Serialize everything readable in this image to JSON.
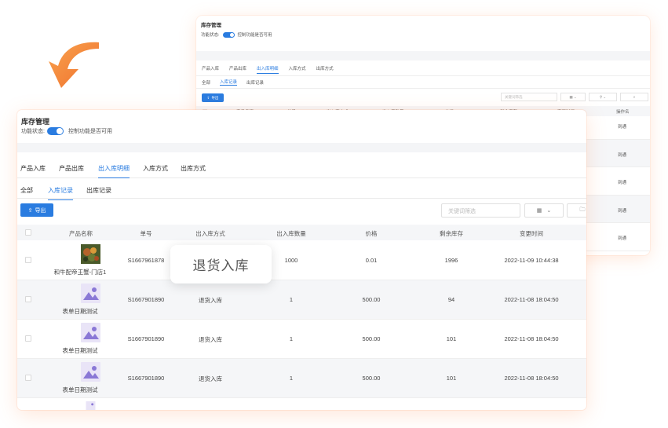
{
  "colors": {
    "accent": "#2a7ce0",
    "arrow": "#f5873a"
  },
  "back_panel": {
    "title": "库存管理",
    "status_label": "功能状态:",
    "status_desc": "控制功能是否可用",
    "tabs": [
      "产品入库",
      "产品出库",
      "出入库明细",
      "入库方式",
      "出库方式"
    ],
    "active_tab": 2,
    "subtabs": [
      "全部",
      "入库记录",
      "出库记录"
    ],
    "active_subtab": 1,
    "export_label": "导出",
    "search_placeholder": "关键词筛选",
    "columns": [
      "产品名称",
      "单号",
      "出入库方式",
      "出入库数量",
      "价格",
      "剩余库存",
      "变更时间",
      "操作名"
    ],
    "row_action": "到通"
  },
  "front_panel": {
    "title": "库存管理",
    "status_label": "功能状态:",
    "status_desc": "控制功能是否可用",
    "tabs": [
      "产品入库",
      "产品出库",
      "出入库明细",
      "入库方式",
      "出库方式"
    ],
    "active_tab": 2,
    "subtabs": [
      "全部",
      "入库记录",
      "出库记录"
    ],
    "active_subtab": 1,
    "export_label": "导出",
    "search_placeholder": "关键词筛选",
    "columns": [
      "产品名称",
      "单号",
      "出入库方式",
      "出入库数量",
      "价格",
      "剩余库存",
      "变更时间"
    ],
    "rows": [
      {
        "name": "和牛配帝王蟹-门店1",
        "order": "S1667961878",
        "method": "",
        "qty": "1000",
        "price": "0.01",
        "stock": "1996",
        "time": "2022-11-09 10:44:38",
        "thumb": "photo"
      },
      {
        "name": "表单日期测试",
        "order": "S1667901890",
        "method": "退货入库",
        "qty": "1",
        "price": "500.00",
        "stock": "94",
        "time": "2022-11-08 18:04:50",
        "thumb": "placeholder"
      },
      {
        "name": "表单日期测试",
        "order": "S1667901890",
        "method": "退货入库",
        "qty": "1",
        "price": "500.00",
        "stock": "101",
        "time": "2022-11-08 18:04:50",
        "thumb": "placeholder"
      },
      {
        "name": "表单日期测试",
        "order": "S1667901890",
        "method": "退货入库",
        "qty": "1",
        "price": "500.00",
        "stock": "101",
        "time": "2022-11-08 18:04:50",
        "thumb": "placeholder"
      }
    ],
    "overlay_label": "退货入库"
  }
}
